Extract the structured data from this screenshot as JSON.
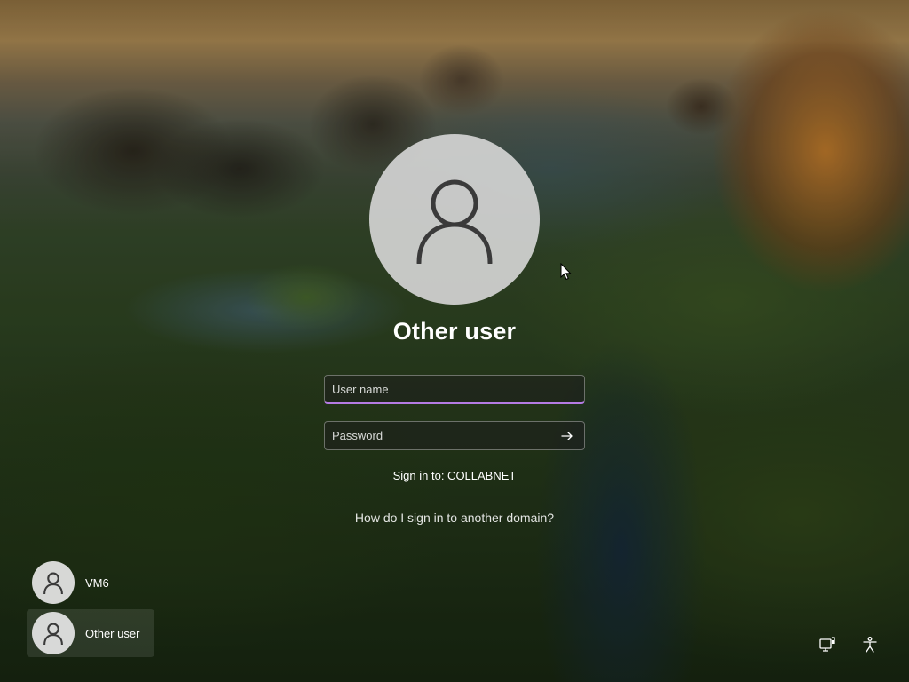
{
  "login": {
    "selected_user": "Other user",
    "username_placeholder": "User name",
    "username_value": "",
    "password_placeholder": "Password",
    "password_value": "",
    "signin_to": "Sign in to: COLLABNET",
    "domain_help_link": "How do I sign in to another domain?"
  },
  "user_list": [
    {
      "label": "VM6",
      "selected": false
    },
    {
      "label": "Other user",
      "selected": true
    }
  ],
  "tray": {
    "network_icon": "network-monitor-icon",
    "accessibility_icon": "accessibility-icon"
  },
  "colors": {
    "input_focus_underline": "#b57be3",
    "avatar_background": "#d7d7d7",
    "avatar_glyph": "#3a3a3a"
  }
}
